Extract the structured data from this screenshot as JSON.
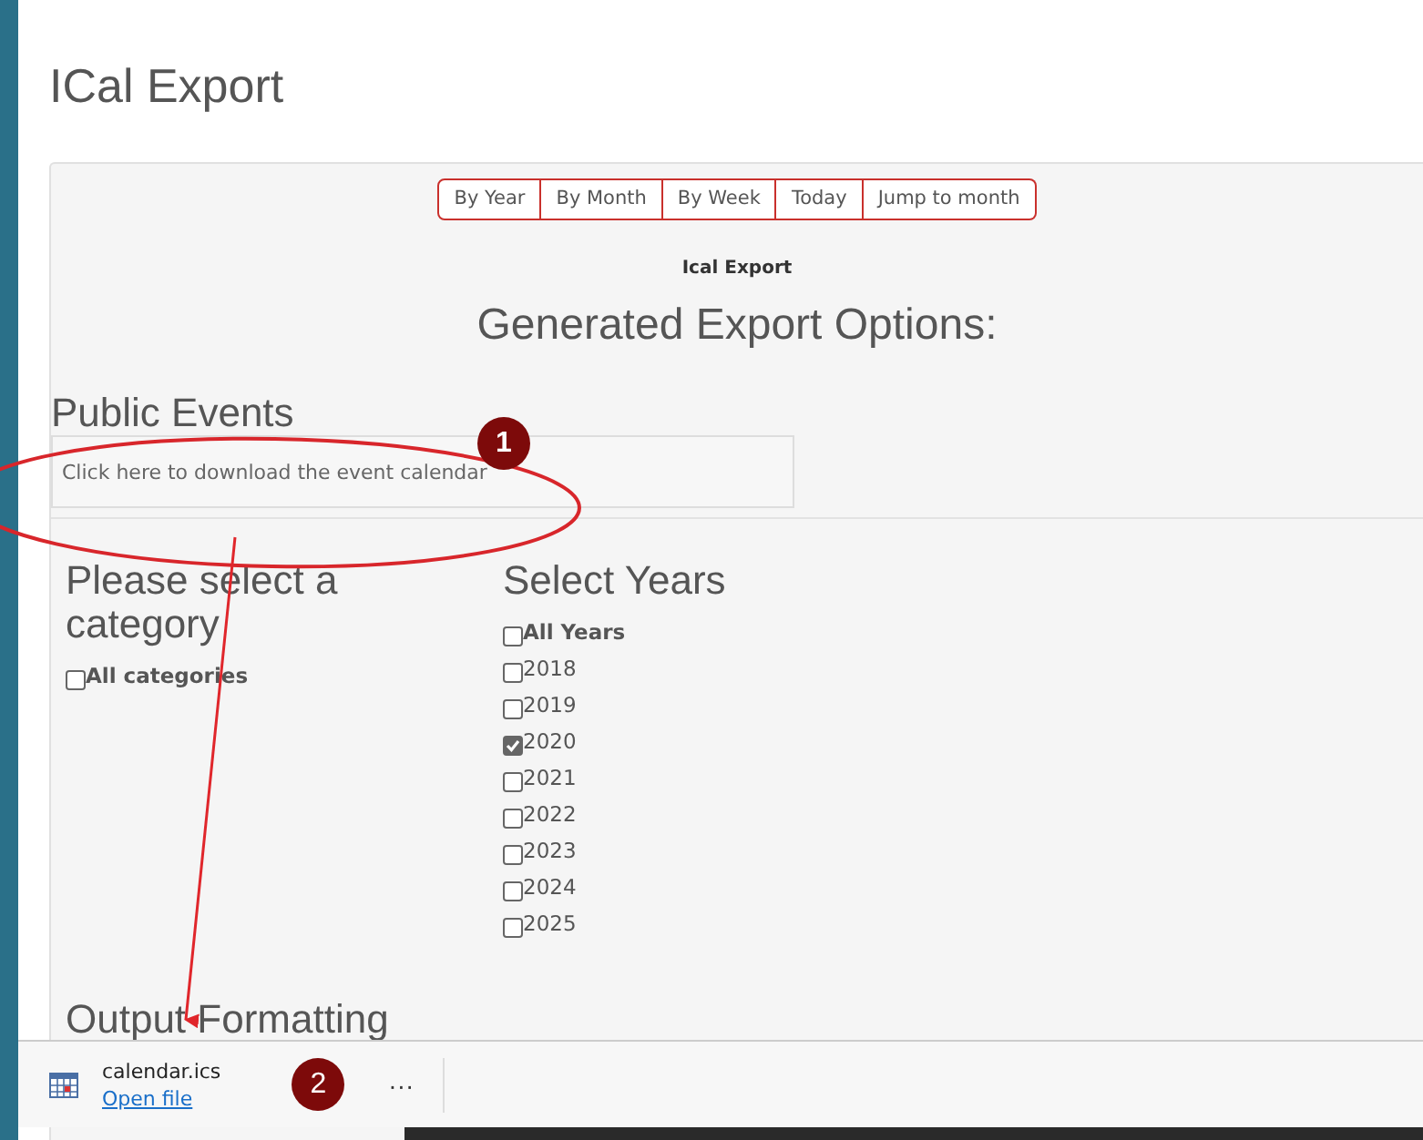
{
  "page_title": "ICal Export",
  "nav_buttons": [
    "By Year",
    "By Month",
    "By Week",
    "Today",
    "Jump to month"
  ],
  "section_label": "Ical Export",
  "heading": "Generated Export Options:",
  "public_events": {
    "title": "Public Events",
    "link": "Click here to download the event calendar"
  },
  "category": {
    "title": "Please select a category",
    "options": [
      {
        "label": "All categories",
        "checked": false
      }
    ]
  },
  "years": {
    "title": "Select Years",
    "options": [
      {
        "label": "All Years",
        "checked": false,
        "kind": "all"
      },
      {
        "label": "2018",
        "checked": false,
        "kind": "year"
      },
      {
        "label": "2019",
        "checked": false,
        "kind": "year"
      },
      {
        "label": "2020",
        "checked": true,
        "kind": "year"
      },
      {
        "label": "2021",
        "checked": false,
        "kind": "year"
      },
      {
        "label": "2022",
        "checked": false,
        "kind": "year"
      },
      {
        "label": "2023",
        "checked": false,
        "kind": "year"
      },
      {
        "label": "2024",
        "checked": false,
        "kind": "year"
      },
      {
        "label": "2025",
        "checked": false,
        "kind": "year"
      }
    ]
  },
  "output_formatting": {
    "title": "Output Formatting"
  },
  "download_bar": {
    "file_name": "calendar.ics",
    "action": "Open file",
    "more": "···"
  },
  "annotations": [
    {
      "number": "1"
    },
    {
      "number": "2"
    }
  ]
}
